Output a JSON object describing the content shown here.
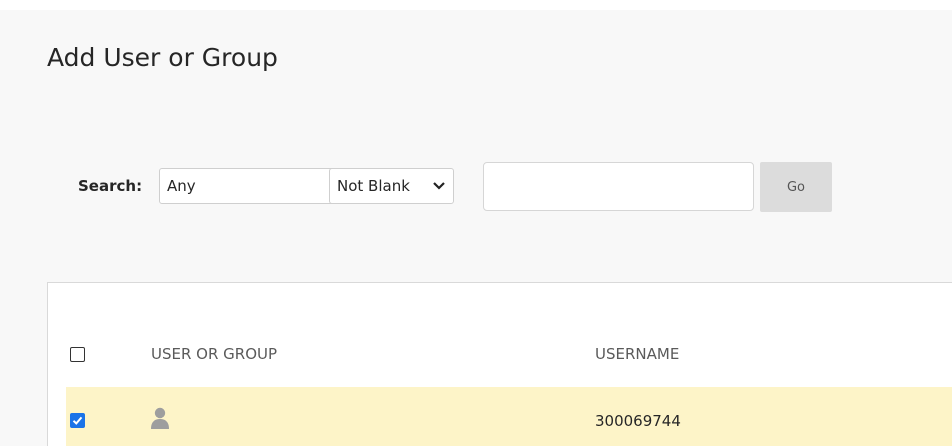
{
  "page": {
    "title": "Add User or Group"
  },
  "search": {
    "label": "Search:",
    "field_select": {
      "selected": "Any"
    },
    "operator_select": {
      "selected": "Not Blank"
    },
    "query_input": {
      "value": "",
      "placeholder": ""
    },
    "go_label": "Go"
  },
  "table": {
    "columns": [
      "USER OR GROUP",
      "USERNAME"
    ],
    "select_all_checked": false,
    "rows": [
      {
        "checked": true,
        "user_or_group": "",
        "icon": "user-silhouette-icon",
        "username": "300069744",
        "highlighted": true
      }
    ]
  },
  "colors": {
    "page_background": "#f8f8f8",
    "row_highlight": "#fdf4c8",
    "checkbox_checked": "#1a73e8",
    "go_button": "#dcdcdc",
    "avatar_icon": "#9e9e9e"
  }
}
